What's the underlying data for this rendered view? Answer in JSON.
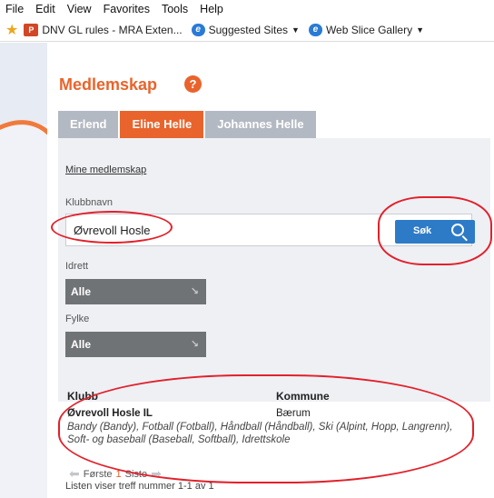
{
  "browser": {
    "menu": [
      "File",
      "Edit",
      "View",
      "Favorites",
      "Tools",
      "Help"
    ],
    "favorites": [
      {
        "icon": "powerpoint-icon",
        "label": "DNV GL rules - MRA Exten...",
        "dropdown": false
      },
      {
        "icon": "ie-icon",
        "label": "Suggested Sites",
        "dropdown": true
      },
      {
        "icon": "ie-icon",
        "label": "Web Slice Gallery",
        "dropdown": true
      }
    ]
  },
  "page": {
    "title": "Medlemskap",
    "help_label": "?",
    "tabs": [
      {
        "label": "Erlend",
        "active": false
      },
      {
        "label": "Eline Helle",
        "active": true
      },
      {
        "label": "Johannes Helle",
        "active": false
      }
    ],
    "my_memberships_link": "Mine medlemskap",
    "club_label": "Klubbnavn",
    "club_value": "Øvrevoll Hosle",
    "search_label": "Søk",
    "sport_label": "Idrett",
    "sport_value": "Alle",
    "county_label": "Fylke",
    "county_value": "Alle"
  },
  "results": {
    "col_club": "Klubb",
    "col_municipality": "Kommune",
    "rows": [
      {
        "club": "Øvrevoll Hosle IL",
        "municipality": "Bærum",
        "sports": "Bandy (Bandy), Fotball (Fotball), Håndball (Håndball), Ski (Alpint, Hopp, Langrenn), Soft- og baseball (Baseball, Softball), Idrettskole"
      }
    ],
    "pager": {
      "first": "Første",
      "current": "1",
      "last": "Siste"
    },
    "summary": "Listen viser treff nummer 1-1 av 1"
  },
  "colors": {
    "accent": "#e8642c",
    "search_button": "#2d7bc6",
    "annotation": "#e2202a"
  }
}
